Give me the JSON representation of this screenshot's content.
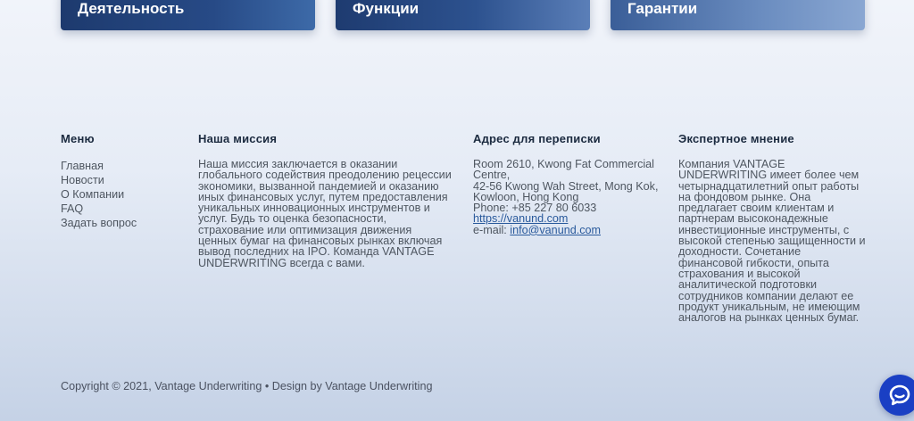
{
  "cards": [
    {
      "title": "Деятельность"
    },
    {
      "title": "Функции"
    },
    {
      "title": "Гарантии"
    }
  ],
  "footer": {
    "menu": {
      "heading": "Меню",
      "items": [
        "Главная",
        "Новости",
        "О Компании",
        "FAQ",
        "Задать вопрос"
      ]
    },
    "mission": {
      "heading": "Наша миссия",
      "text": "Наша миссия заключается в оказании глобального содействия преодолению рецессии экономики, вызванной пандемией и оказанию иных финансовых услуг, путем предоставления уникальных инновационных инструментов и услуг. Будь то оценка безопасности, страхование или оптимизация движения ценных бумаг на финансовых рынках включая вывод последних на IPO. Команда VANTAGE UNDERWRITING всегда с вами."
    },
    "address": {
      "heading": "Адрес для переписки",
      "line1": "Room 2610, Kwong Fat Commercial Centre,",
      "line2": "42-56 Kwong Wah Street, Mong Kok, Kowloon, Hong Kong",
      "phone": "Phone: +85 227 80 6033",
      "website": "https://vanund.com",
      "email_label": "e-mail:",
      "email": "info@vanund.com"
    },
    "expert": {
      "heading": "Экспертное мнение",
      "text": "Компания VANTAGE UNDERWRITING имеет более чем четырнадцатилетний опыт работы на фондовом рынке. Она предлагает своим клиентам и партнерам высоконадежные инвестиционные инструменты, с высокой степенью защищенности и доходности. Сочетание финансовой гибкости, опыта страхования и высокой аналитической подготовки сотрудников компании делают ее продукт уникальным, не имеющим аналогов на рынках ценных бумаг."
    },
    "copyright": "Copyright © 2021, Vantage Underwriting • Design by Vantage Underwriting"
  },
  "chat": {
    "icon": "chat-bubble-icon"
  },
  "colors": {
    "accent": "#1a3fc4",
    "card_dark": "#1d3a6e",
    "link": "#2a5a9c"
  }
}
